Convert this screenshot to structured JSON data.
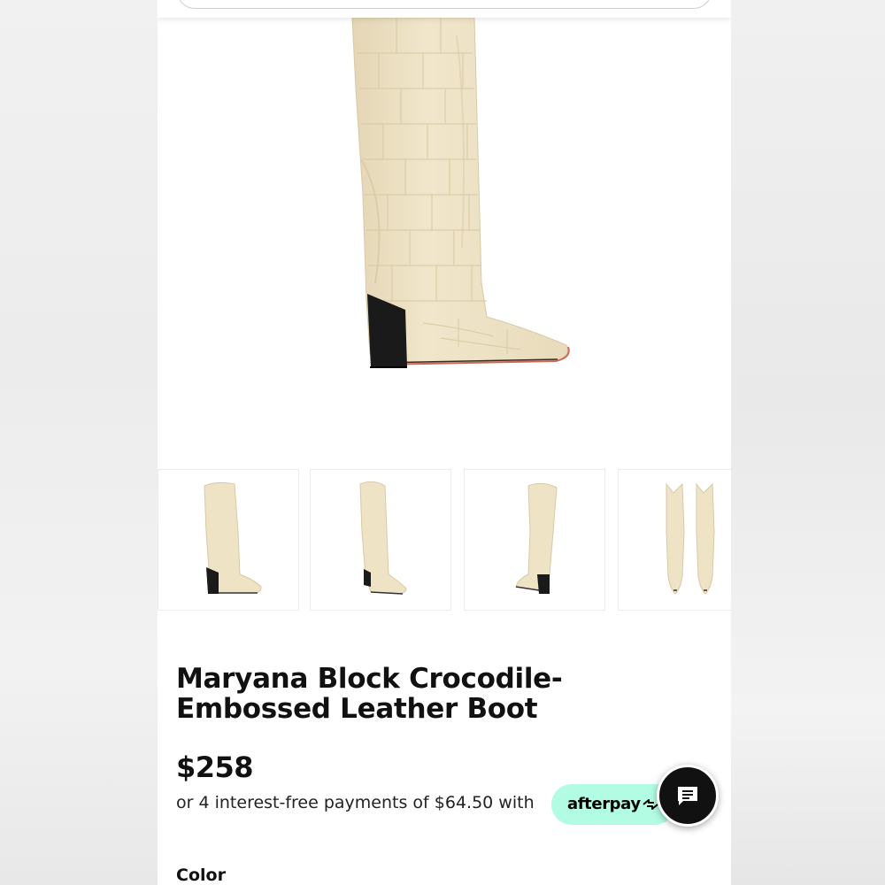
{
  "product": {
    "title": "Maryana Block Crocodile-Embossed Leather Boot",
    "price": "$258",
    "installment_text": "or 4 interest-free payments of $64.50 with",
    "payment_provider": "afterpay",
    "color_label": "Color"
  },
  "gallery": {
    "thumbnails": [
      "side-view",
      "front-angle-view",
      "back-angle-view",
      "front-pair-view"
    ]
  },
  "icons": {
    "afterpay_logo": "afterpay-arrows-icon",
    "chat": "chat-bubble-icon"
  },
  "colors": {
    "afterpay_mint": "#b2fce4",
    "boot_cream": "#efe3c6",
    "heel_black": "#1a1a1a",
    "chat_button": "#111111"
  }
}
